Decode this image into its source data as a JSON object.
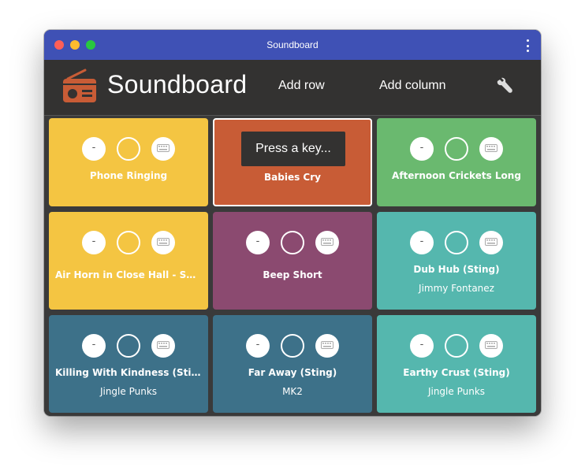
{
  "window": {
    "title": "Soundboard"
  },
  "toolbar": {
    "app_title": "Soundboard",
    "add_row_label": "Add row",
    "add_column_label": "Add column",
    "settings_icon": "wrench-icon"
  },
  "colors": {
    "titlebar": "#3f51b5",
    "toolbar": "#333231",
    "yellow": "#f4c542",
    "orange": "#c85c36",
    "green": "#6ab96f",
    "purple": "#8b4a70",
    "teal": "#55b7ae",
    "slate": "#3d7189"
  },
  "tiles": [
    {
      "title": "Phone Ringing",
      "subtitle": "",
      "color": "#f4c542",
      "volume_label": "-",
      "listening": false
    },
    {
      "title": "Babies Cry",
      "subtitle": "",
      "color": "#c85c36",
      "volume_label": "-",
      "listening": true,
      "overlay": "Press a key..."
    },
    {
      "title": "Afternoon Crickets Long",
      "subtitle": "",
      "color": "#6ab96f",
      "volume_label": "-",
      "listening": false
    },
    {
      "title": "Air Horn in Close Hall - Se...",
      "subtitle": "",
      "color": "#f4c542",
      "volume_label": "-",
      "listening": false
    },
    {
      "title": "Beep Short",
      "subtitle": "",
      "color": "#8b4a70",
      "volume_label": "-",
      "listening": false
    },
    {
      "title": "Dub Hub (Sting)",
      "subtitle": "Jimmy Fontanez",
      "color": "#55b7ae",
      "volume_label": "-",
      "listening": false
    },
    {
      "title": "Killing With Kindness (Sti...",
      "subtitle": "Jingle Punks",
      "color": "#3d7189",
      "volume_label": "-",
      "listening": false
    },
    {
      "title": "Far Away (Sting)",
      "subtitle": "MK2",
      "color": "#3d7189",
      "volume_label": "-",
      "listening": false
    },
    {
      "title": "Earthy Crust (Sting)",
      "subtitle": "Jingle Punks",
      "color": "#55b7ae",
      "volume_label": "-",
      "listening": false
    }
  ]
}
